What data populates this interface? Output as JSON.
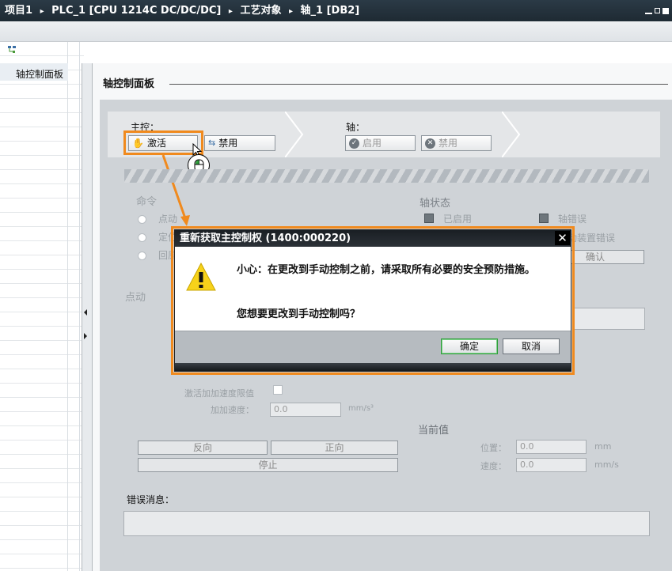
{
  "window": {
    "breadcrumb": [
      "项目1",
      "PLC_1 [CPU 1214C DC/DC/DC]",
      "工艺对象",
      "轴_1 [DB2]"
    ],
    "separator": "▸"
  },
  "nav": {
    "item": "轴控制面板"
  },
  "panel": {
    "title": "轴控制面板",
    "master_label": "主控：",
    "activate_label": "激活",
    "disable_master_label": "禁用",
    "axis_label": "轴：",
    "enable_axis_label": "启用",
    "disable_axis_label": "禁用",
    "command_label": "命令",
    "commands": [
      "点动",
      "定位",
      "回原点"
    ],
    "axis_status_label": "轴状态",
    "status_enabled": "已启用",
    "status_axis_error": "轴错误",
    "status_drive_error": "驱动装置错误",
    "confirm_label": "确认",
    "jog_label": "点动",
    "jerk_limit_label": "激活加加速度限值",
    "jerk_label": "加加速度：",
    "jerk_value": "0.0",
    "jerk_unit": "mm/s³",
    "current_values_label": "当前值",
    "reverse_label": "反向",
    "forward_label": "正向",
    "stop_label": "停止",
    "position_label": "位置：",
    "position_value": "0.0",
    "position_unit": "mm",
    "speed_label": "速度：",
    "speed_value": "0.0",
    "speed_unit": "mm/s",
    "error_label": "错误消息："
  },
  "dialog": {
    "title": "重新获取主控制权 (1400:000220)",
    "message": "小心：在更改到手动控制之前，请采取所有必要的安全预防措施。",
    "question": "您想要更改到手动控制吗？",
    "ok_label": "确定",
    "cancel_label": "取消"
  },
  "colors": {
    "highlight": "#f08a1e",
    "title_bar": "#1e2a33",
    "ok_accent": "#2e9e3a"
  }
}
